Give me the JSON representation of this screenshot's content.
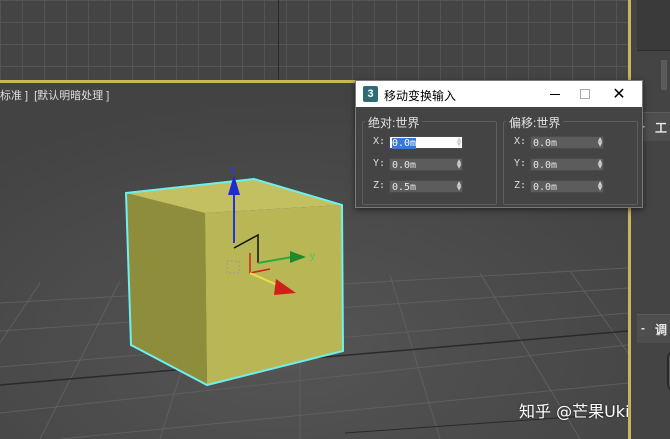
{
  "viewport": {
    "label_view": "标准 ]",
    "label_shading": "[默认明暗处理 ]",
    "gizmo_axis_z": "z",
    "gizmo_axis_y": "y",
    "object_color": "#c5c25a",
    "selection_color": "#6ef0f0"
  },
  "dialog": {
    "app_icon": "3",
    "title": "移动变换输入",
    "close_glyph": "✕",
    "absolute": {
      "title": "绝对:世界",
      "fields": [
        {
          "label": "X:",
          "value": "0.0m"
        },
        {
          "label": "Y:",
          "value": "0.0m"
        },
        {
          "label": "Z:",
          "value": "0.5m"
        }
      ]
    },
    "offset": {
      "title": "偏移:世界",
      "fields": [
        {
          "label": "X:",
          "value": "0.0m"
        },
        {
          "label": "Y:",
          "value": "0.0m"
        },
        {
          "label": "Z:",
          "value": "0.0m"
        }
      ]
    }
  },
  "right_panel": {
    "rollout_1": {
      "sign": "-",
      "label": "工"
    },
    "rollout_2": {
      "sign": "-",
      "label": "调"
    }
  },
  "watermark": "知乎 @芒果Uki"
}
